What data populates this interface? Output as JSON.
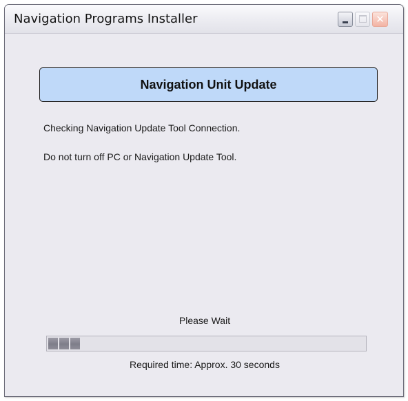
{
  "window": {
    "title": "Navigation Programs Installer",
    "controls": {
      "minimize": "minimize-icon",
      "maximize": "maximize-icon",
      "close": "close-icon"
    }
  },
  "banner": {
    "title": "Navigation Unit Update",
    "background": "#bfd9f9"
  },
  "messages": {
    "status": "Checking Navigation Update Tool Connection.",
    "warning": "Do not turn off PC or Navigation Update Tool."
  },
  "progress": {
    "label": "Please Wait",
    "value_fraction": 0.1,
    "blocks_filled": 3,
    "fill_color": "#8a8995"
  },
  "footer": {
    "required_time": "Required time: Approx. 30 seconds"
  }
}
